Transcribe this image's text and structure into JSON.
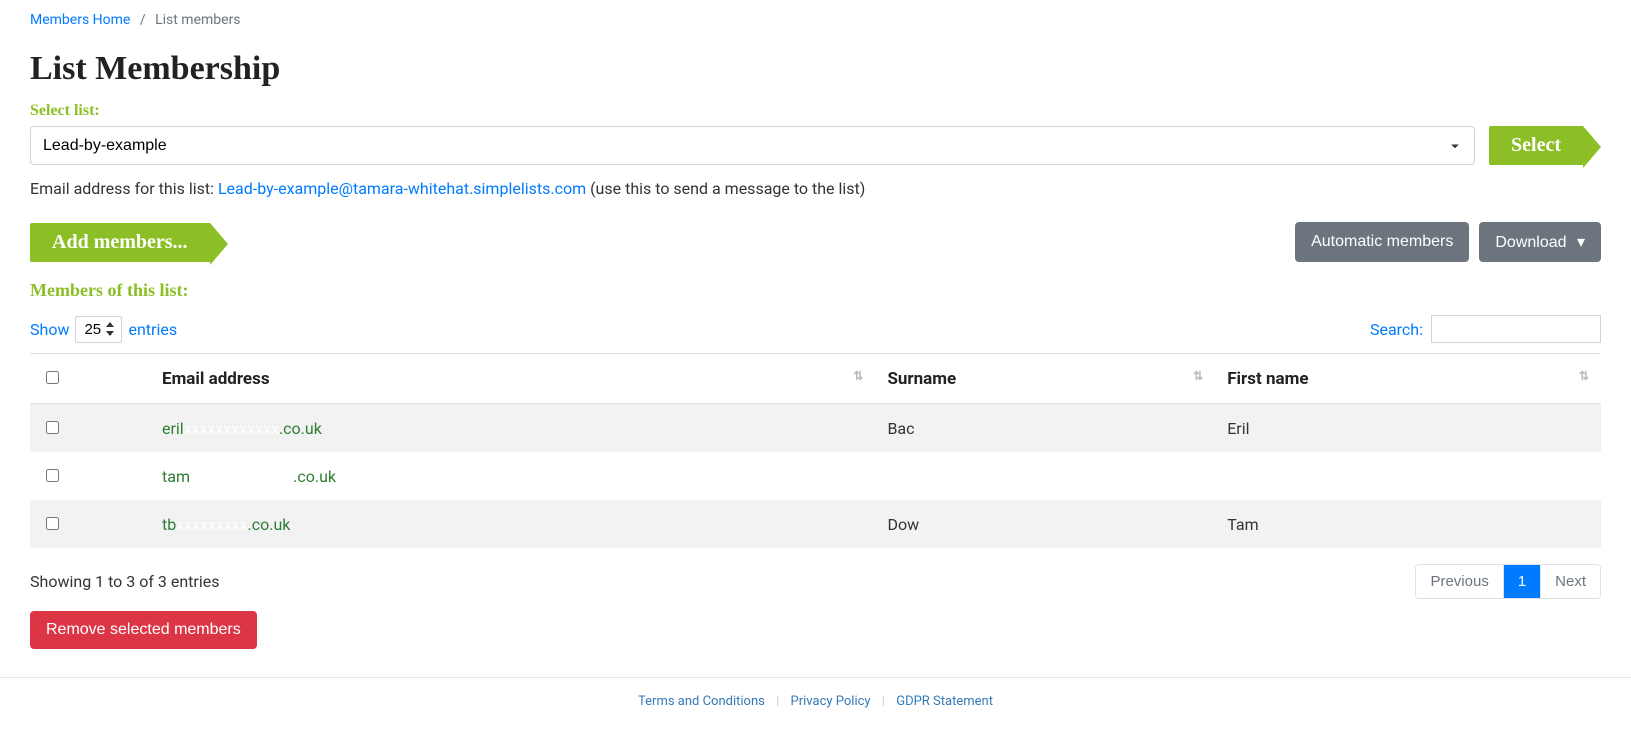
{
  "breadcrumb": {
    "home": "Members Home",
    "current": "List members"
  },
  "page_title": "List Membership",
  "select_list_label": "Select list:",
  "list_dropdown": {
    "selected": "Lead-by-example"
  },
  "select_button": "Select",
  "email_line": {
    "prefix": "Email address for this list: ",
    "link": "Lead-by-example@tamara-whitehat.simplelists.com",
    "suffix": " (use this to send a message to the list)"
  },
  "add_members_button": "Add members...",
  "automatic_members_button": "Automatic members",
  "download_button": "Download",
  "members_header": "Members of this list:",
  "datatable": {
    "show": "Show",
    "entries": "entries",
    "length_value": "25",
    "search_label": "Search:",
    "columns": {
      "email": "Email address",
      "surname": "Surname",
      "firstname": "First name"
    },
    "rows": [
      {
        "email_left": "eril",
        "email_right": ".co.uk",
        "surname": "Bac",
        "firstname": "Eril"
      },
      {
        "email_left": "tam",
        "email_right": ".co.uk",
        "surname": "",
        "firstname": ""
      },
      {
        "email_left": "tb",
        "email_right": ".co.uk",
        "surname": "Dow",
        "firstname": "Tam"
      }
    ],
    "info": "Showing 1 to 3 of 3 entries",
    "prev": "Previous",
    "page": "1",
    "next": "Next"
  },
  "remove_button": "Remove selected members",
  "footer": {
    "terms": "Terms and Conditions",
    "privacy": "Privacy Policy",
    "gdpr": "GDPR Statement"
  }
}
